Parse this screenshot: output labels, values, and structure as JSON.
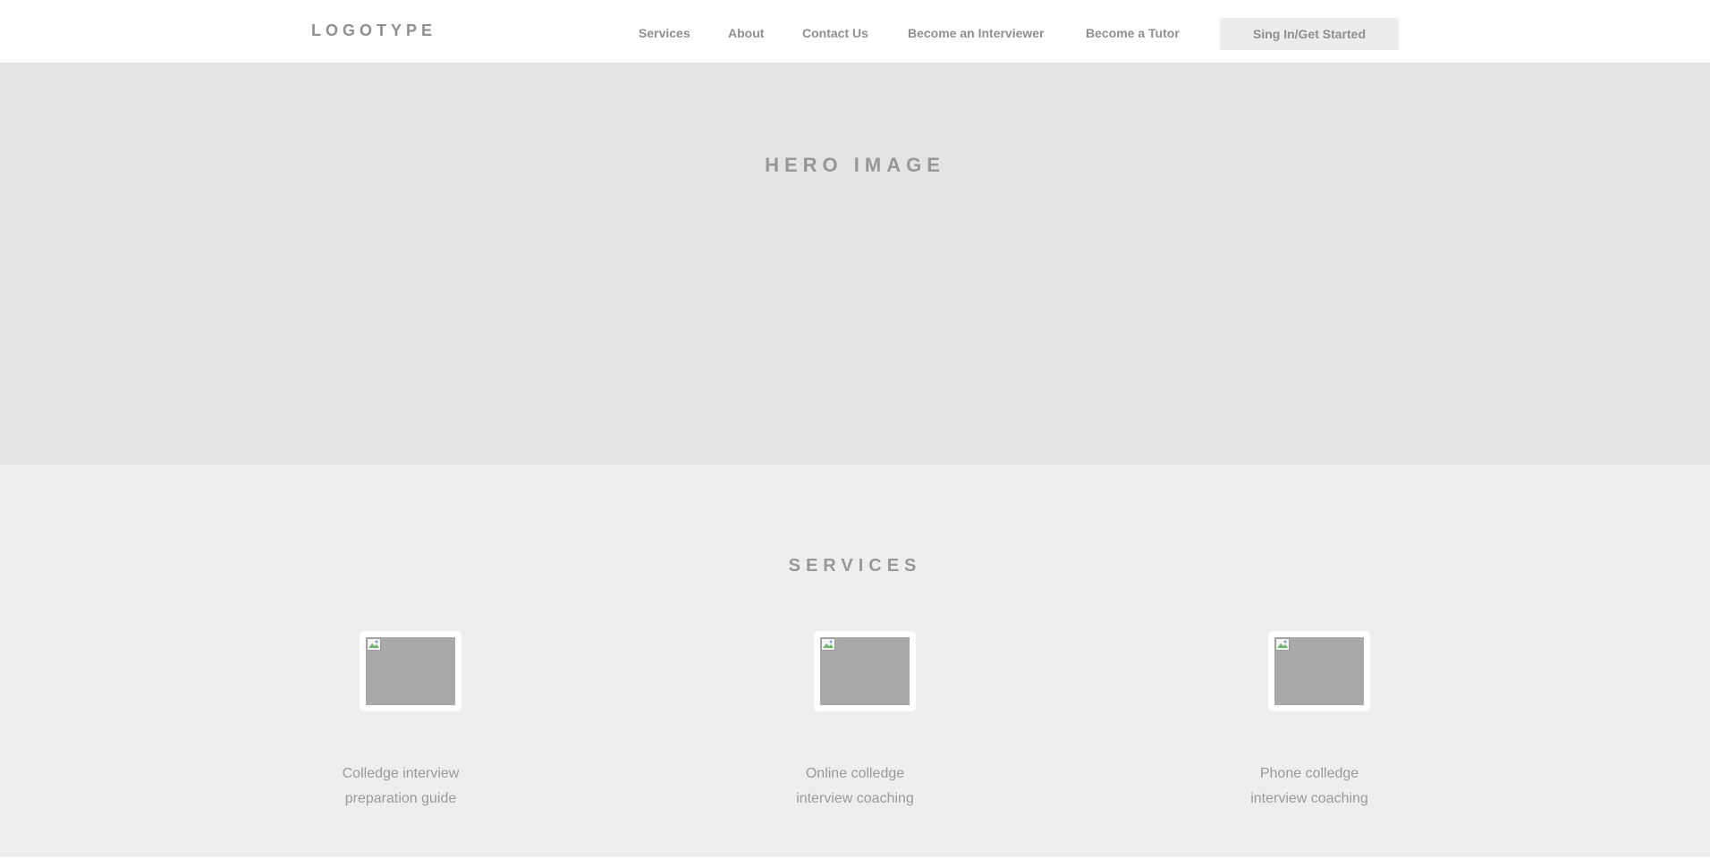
{
  "header": {
    "logo": "LOGOTYPE",
    "nav": [
      {
        "label": "Services"
      },
      {
        "label": "About"
      },
      {
        "label": "Contact Us"
      },
      {
        "label": "Become an Interviewer"
      },
      {
        "label": "Become a Tutor"
      }
    ],
    "cta_label": "Sing In/Get Started"
  },
  "hero": {
    "title": "HERO IMAGE"
  },
  "services": {
    "title": "SERVICES",
    "items": [
      {
        "line1": "Colledge interview",
        "line2": "preparation guide",
        "icon": "broken-image-icon"
      },
      {
        "line1": "Online colledge",
        "line2": "interview coaching",
        "icon": "broken-image-icon"
      },
      {
        "line1": "Phone colledge",
        "line2": "interview coaching",
        "icon": "broken-image-icon"
      }
    ]
  },
  "colors": {
    "header_bg": "#ffffff",
    "hero_bg": "#e4e4e4",
    "services_bg": "#eeeeee",
    "text": "#8f8f8f",
    "button_bg": "#ececec",
    "image_placeholder": "#a9a9a9"
  }
}
